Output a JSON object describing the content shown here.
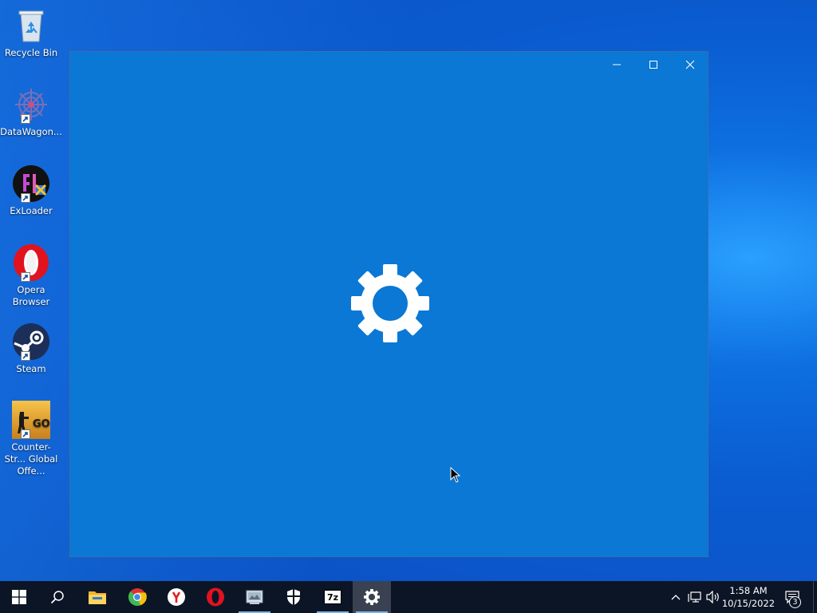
{
  "desktop": {
    "icons": [
      {
        "label": "Recycle Bin",
        "icon": "recycle-bin-icon"
      },
      {
        "label": "DataWagon...",
        "icon": "datawagon-icon"
      },
      {
        "label": "ExLoader",
        "icon": "exloader-icon"
      },
      {
        "label": "Opera Browser",
        "icon": "opera-icon"
      },
      {
        "label": "Steam",
        "icon": "steam-icon"
      },
      {
        "label": "Counter-Str... Global Offe...",
        "icon": "csgo-icon"
      }
    ]
  },
  "window": {
    "app": "Settings",
    "splash_icon": "gear-icon",
    "controls": [
      "minimize",
      "maximize",
      "close"
    ],
    "accent": "#0a78d4"
  },
  "taskbar": {
    "buttons": [
      {
        "name": "start",
        "icon": "windows-logo-icon"
      },
      {
        "name": "search",
        "icon": "search-icon"
      },
      {
        "name": "file-explorer",
        "icon": "folder-icon"
      },
      {
        "name": "chrome",
        "icon": "chrome-icon"
      },
      {
        "name": "yandex-browser",
        "icon": "yandex-icon"
      },
      {
        "name": "opera",
        "icon": "opera-icon"
      },
      {
        "name": "datawagon",
        "icon": "datawagon-icon"
      },
      {
        "name": "windows-security",
        "icon": "shield-icon"
      },
      {
        "name": "7-zip",
        "icon": "7zip-icon"
      },
      {
        "name": "settings",
        "icon": "gear-icon"
      }
    ],
    "sevenzip_label": "7z",
    "tray": {
      "icons": [
        "chevron-up-icon",
        "network-icon",
        "volume-icon"
      ],
      "time": "1:58 AM",
      "date": "10/15/2022",
      "notification_count": "3"
    },
    "background": "#0c1526"
  }
}
